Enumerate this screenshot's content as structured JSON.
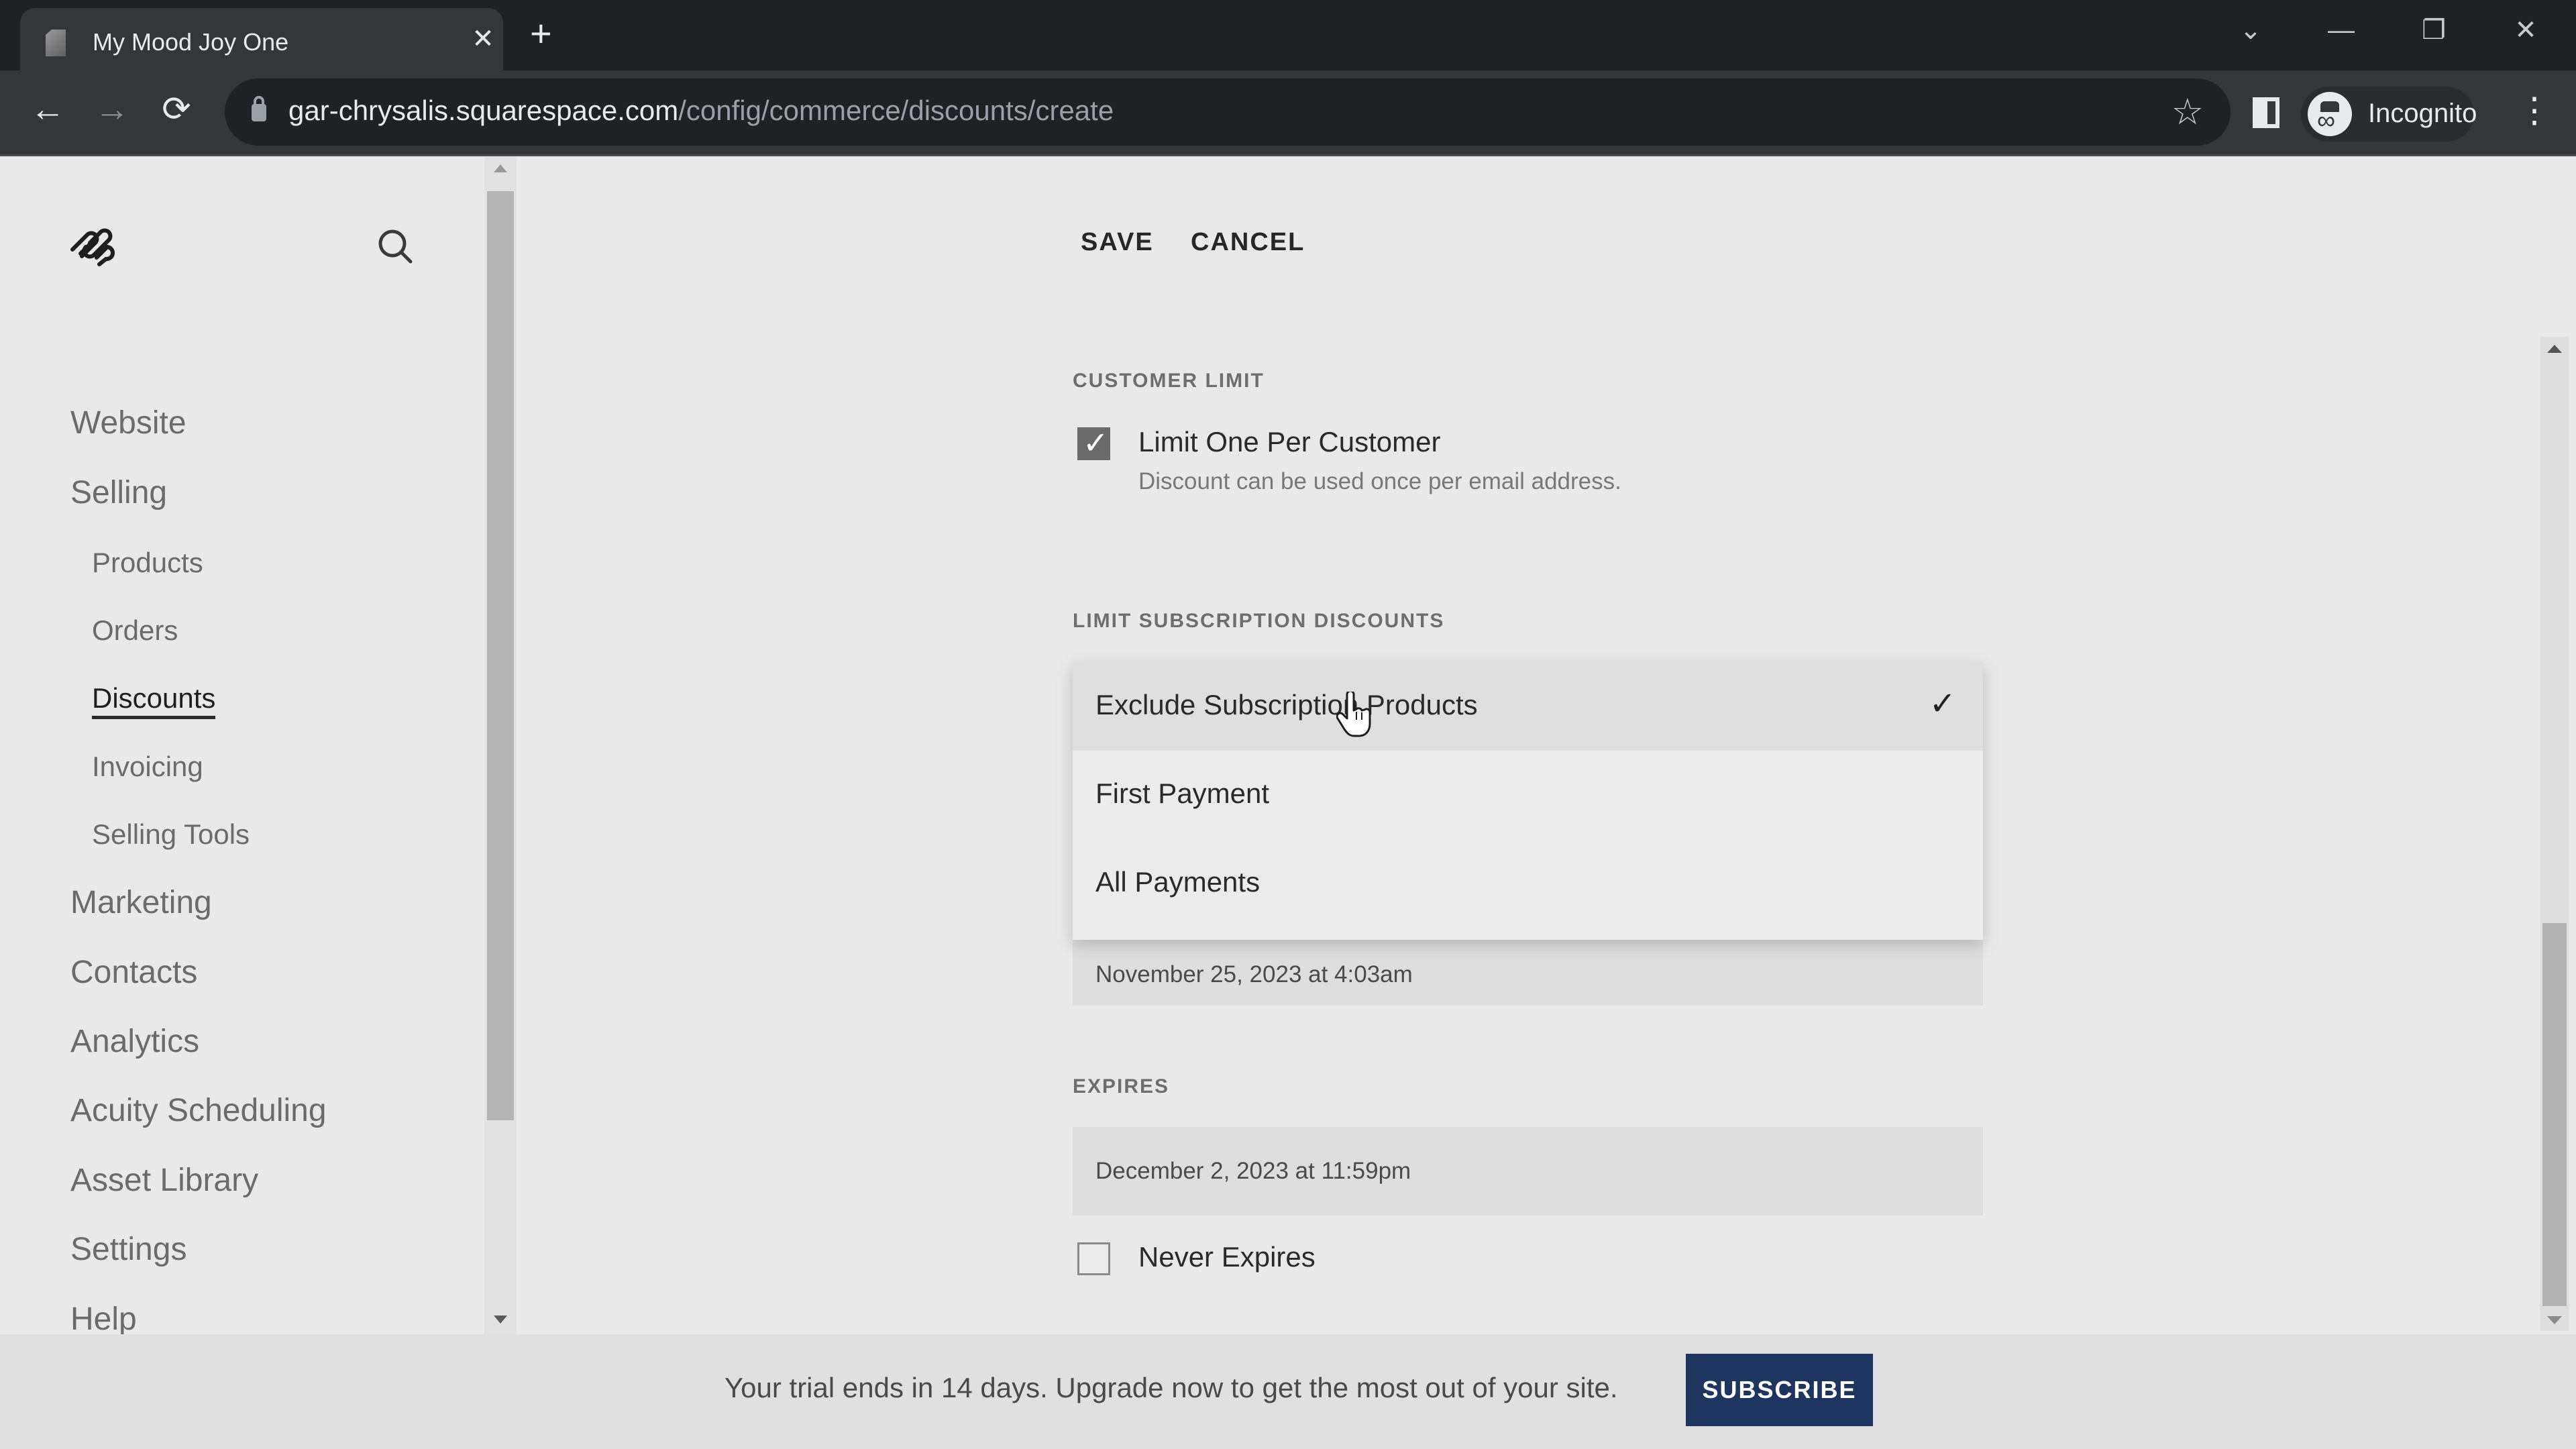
{
  "browser": {
    "tab_title": "My Mood Joy One",
    "new_tab_label": "+",
    "url_host": "gar-chrysalis.squarespace.com",
    "url_path": "/config/commerce/discounts/create",
    "profile_label": "Incognito",
    "icons": {
      "back": "←",
      "forward": "→",
      "reload": "⟳",
      "star": "☆",
      "menu": "⋮",
      "tab_close": "✕",
      "tab_list": "⌄",
      "minimize": "—",
      "restore": "❐",
      "window_close": "✕"
    }
  },
  "sidebar": {
    "items": [
      {
        "label": "Website",
        "level": "main"
      },
      {
        "label": "Selling",
        "level": "main"
      },
      {
        "label": "Products",
        "level": "sub"
      },
      {
        "label": "Orders",
        "level": "sub"
      },
      {
        "label": "Discounts",
        "level": "sub",
        "active": true
      },
      {
        "label": "Invoicing",
        "level": "sub"
      },
      {
        "label": "Selling Tools",
        "level": "sub"
      },
      {
        "label": "Marketing",
        "level": "main"
      },
      {
        "label": "Contacts",
        "level": "main"
      },
      {
        "label": "Analytics",
        "level": "main"
      },
      {
        "label": "Acuity Scheduling",
        "level": "main"
      },
      {
        "label": "Asset Library",
        "level": "main"
      },
      {
        "label": "Settings",
        "level": "main"
      },
      {
        "label": "Help",
        "level": "main"
      }
    ]
  },
  "header": {
    "save_label": "SAVE",
    "cancel_label": "CANCEL"
  },
  "customer_limit": {
    "section_label": "CUSTOMER LIMIT",
    "checkbox_label": "Limit One Per Customer",
    "checkbox_checked": true,
    "description": "Discount can be used once per email address."
  },
  "subscription_limit": {
    "section_label": "LIMIT SUBSCRIPTION DISCOUNTS",
    "options": [
      {
        "label": "Exclude Subscription Products",
        "selected": true
      },
      {
        "label": "First Payment",
        "selected": false
      },
      {
        "label": "All Payments",
        "selected": false
      }
    ],
    "selected_check": "✓"
  },
  "start_date": {
    "value": "November 25, 2023 at 4:03am"
  },
  "expires": {
    "section_label": "EXPIRES",
    "value": "December 2, 2023 at 11:59pm",
    "never_expires_label": "Never Expires",
    "never_expires_checked": false
  },
  "banner": {
    "message": "Your trial ends in 14 days. Upgrade now to get the most out of your site.",
    "subscribe_label": "SUBSCRIBE",
    "subscribe_color": "#1e3560"
  }
}
